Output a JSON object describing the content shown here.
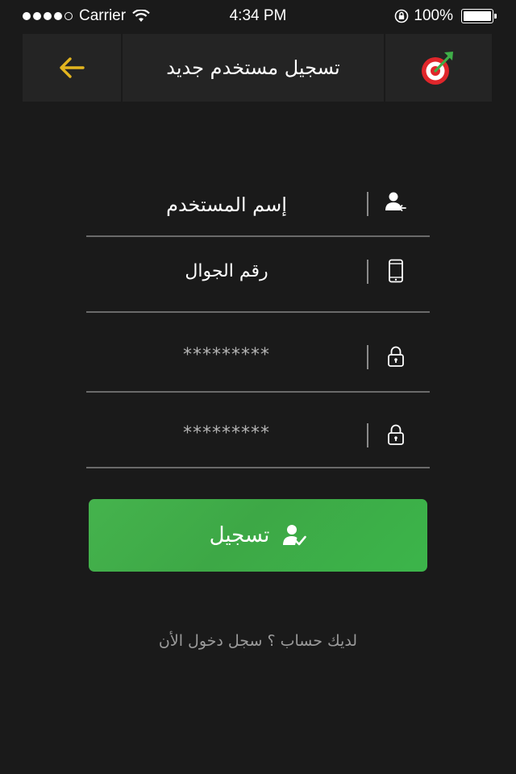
{
  "status_bar": {
    "carrier": "Carrier",
    "time": "4:34 PM",
    "battery": "100%",
    "battery_level": 1.0
  },
  "nav": {
    "title": "تسجيل مستخدم جديد",
    "back_icon": "arrow-left-icon",
    "logo_icon": "target-logo-icon",
    "accent_color": "#e3b51f"
  },
  "form": {
    "fields": [
      {
        "icon": "user-icon",
        "value": "إسم المستخدم"
      },
      {
        "icon": "mobile-phone-icon",
        "value": "رقم الجوال"
      },
      {
        "icon": "lock-icon",
        "value": "*********"
      },
      {
        "icon": "lock-icon",
        "value": "*********"
      }
    ]
  },
  "register_button": {
    "label": "تسجيل",
    "icon": "user-check-icon",
    "color": "#3fae48"
  },
  "login_link": "لديك حساب ؟ سجل دخول الأن"
}
